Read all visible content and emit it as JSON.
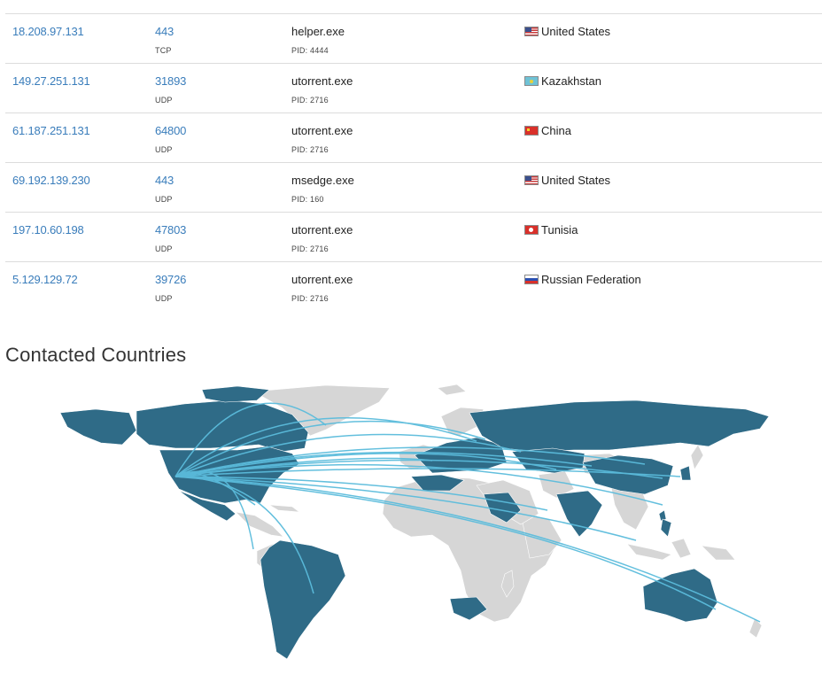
{
  "connections": [
    {
      "ip": "",
      "port": "",
      "protocol": "TCP",
      "process": "",
      "pid": "PID: 4444",
      "country": "",
      "flag": "us"
    },
    {
      "ip": "18.208.97.131",
      "port": "443",
      "protocol": "TCP",
      "process": "helper.exe",
      "pid": "PID: 4444",
      "country": "United States",
      "flag": "us"
    },
    {
      "ip": "149.27.251.131",
      "port": "31893",
      "protocol": "UDP",
      "process": "utorrent.exe",
      "pid": "PID: 2716",
      "country": "Kazakhstan",
      "flag": "kz"
    },
    {
      "ip": "61.187.251.131",
      "port": "64800",
      "protocol": "UDP",
      "process": "utorrent.exe",
      "pid": "PID: 2716",
      "country": "China",
      "flag": "cn"
    },
    {
      "ip": "69.192.139.230",
      "port": "443",
      "protocol": "UDP",
      "process": "msedge.exe",
      "pid": "PID: 160",
      "country": "United States",
      "flag": "us"
    },
    {
      "ip": "197.10.60.198",
      "port": "47803",
      "protocol": "UDP",
      "process": "utorrent.exe",
      "pid": "PID: 2716",
      "country": "Tunisia",
      "flag": "tn"
    },
    {
      "ip": "5.129.129.72",
      "port": "39726",
      "protocol": "UDP",
      "process": "utorrent.exe",
      "pid": "PID: 2716",
      "country": "Russian Federation",
      "flag": "ru"
    }
  ],
  "section": {
    "title": "Contacted Countries"
  },
  "map": {
    "highlight_color": "#2f6b87",
    "base_color": "#d6d6d6",
    "arc_color": "#5bbcdc"
  }
}
